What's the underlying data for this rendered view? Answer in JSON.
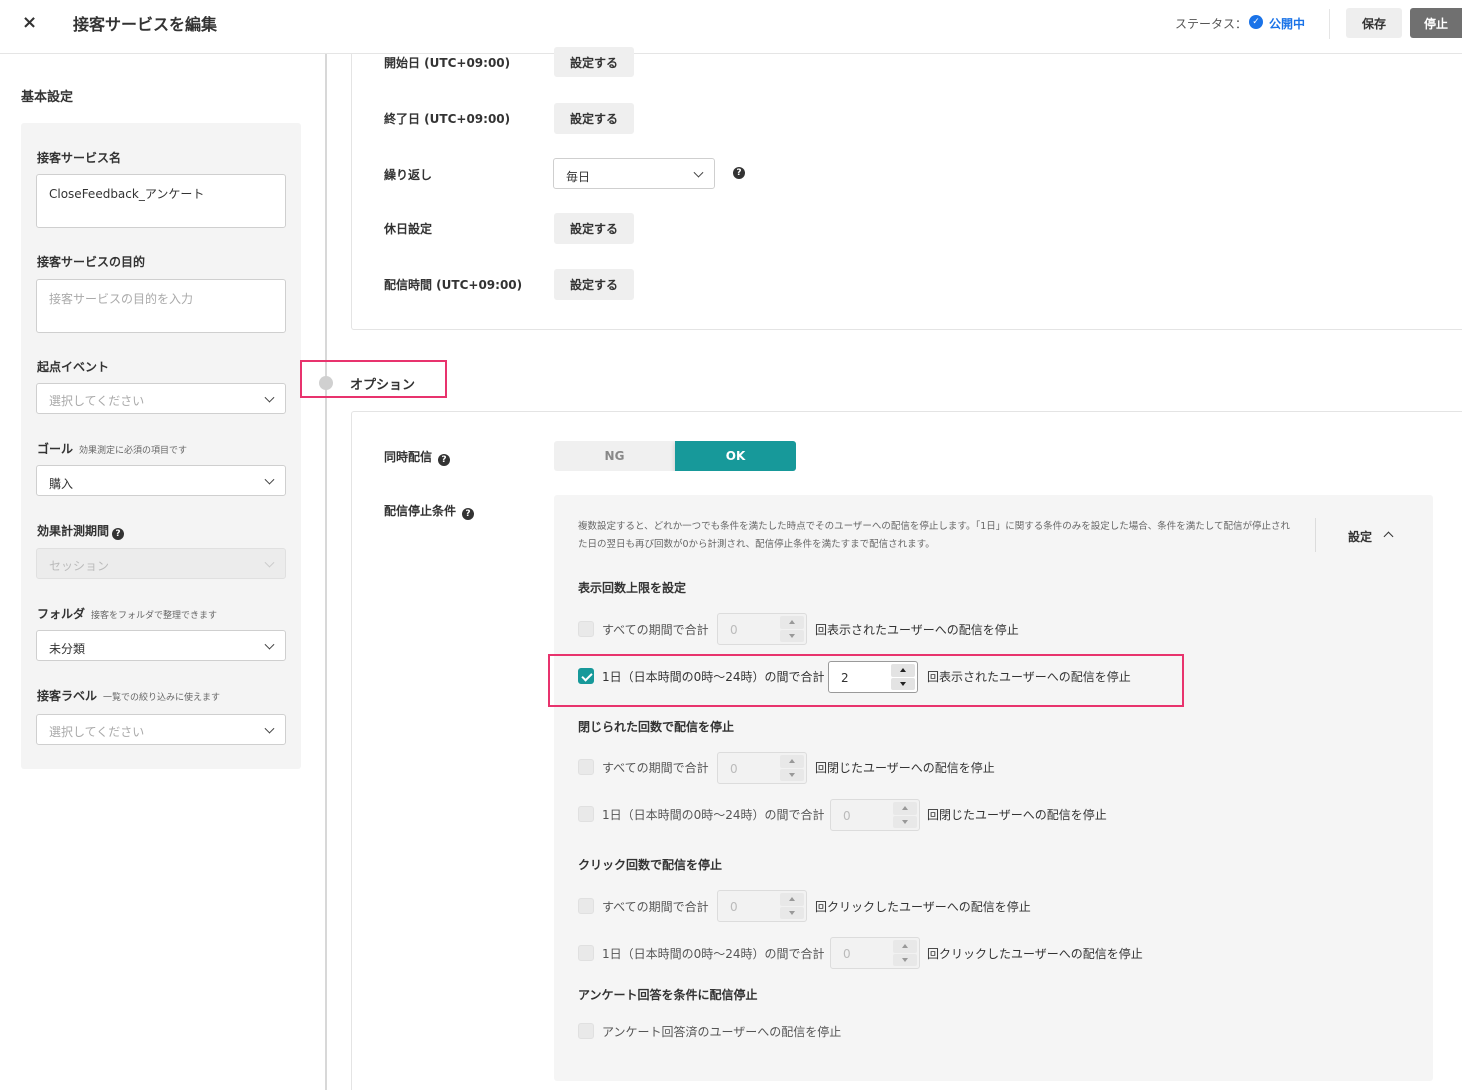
{
  "header": {
    "close_glyph": "×",
    "title": "接客サービスを編集",
    "status_label": "ステータス：",
    "status_value": "公開中",
    "save_label": "保存",
    "stop_label": "停止"
  },
  "left": {
    "heading": "基本設定",
    "name_label": "接客サービス名",
    "name_value": "CloseFeedback_アンケート",
    "purpose_label": "接客サービスの目的",
    "purpose_placeholder": "接客サービスの目的を入力",
    "event_label": "起点イベント",
    "event_placeholder": "選択してください",
    "goal_label": "ゴール",
    "goal_note": "効果測定に必須の項目です",
    "goal_value": "購入",
    "measure_label": "効果計測期間",
    "measure_value": "セッション",
    "folder_label": "フォルダ",
    "folder_note": "接客をフォルダで整理できます",
    "folder_value": "未分類",
    "tag_label": "接客ラベル",
    "tag_note": "一覧での絞り込みに使えます",
    "tag_placeholder": "選択してください"
  },
  "schedule": {
    "start_label": "開始日 (UTC+09:00)",
    "end_label": "終了日 (UTC+09:00)",
    "repeat_label": "繰り返し",
    "repeat_value": "毎日",
    "holiday_label": "休日設定",
    "time_label": "配信時間 (UTC+09:00)",
    "set_label": "設定する"
  },
  "options": {
    "title": "オプション",
    "concurrent_label": "同時配信",
    "ng_label": "NG",
    "ok_label": "OK",
    "stop_label": "配信停止条件",
    "description": "複数設定すると、どれか一つでも条件を満たした時点でそのユーザーへの配信を停止します。「1日」に関する条件のみを設定した場合、条件を満たして配信が停止された日の翌日も再び回数が0から計測され、配信停止条件を満たすまで配信されます。",
    "settings_toggle": "設定",
    "sections": {
      "display_title": "表示回数上限を設定",
      "close_title": "閉じられた回数で配信を停止",
      "click_title": "クリック回数で配信を停止",
      "survey_title": "アンケート回答を条件に配信停止"
    },
    "rows": {
      "all_period": "すべての期間で合計",
      "one_day": "1日（日本時間の0時〜24時）の間で合計",
      "display_suffix": "回表示されたユーザーへの配信を停止",
      "close_suffix": "回閉じたユーザーへの配信を停止",
      "click_suffix": "回クリックしたユーザーへの配信を停止",
      "survey_text": "アンケート回答済のユーザーへの配信を停止",
      "default_value": "0",
      "display_day_value": "2"
    }
  }
}
